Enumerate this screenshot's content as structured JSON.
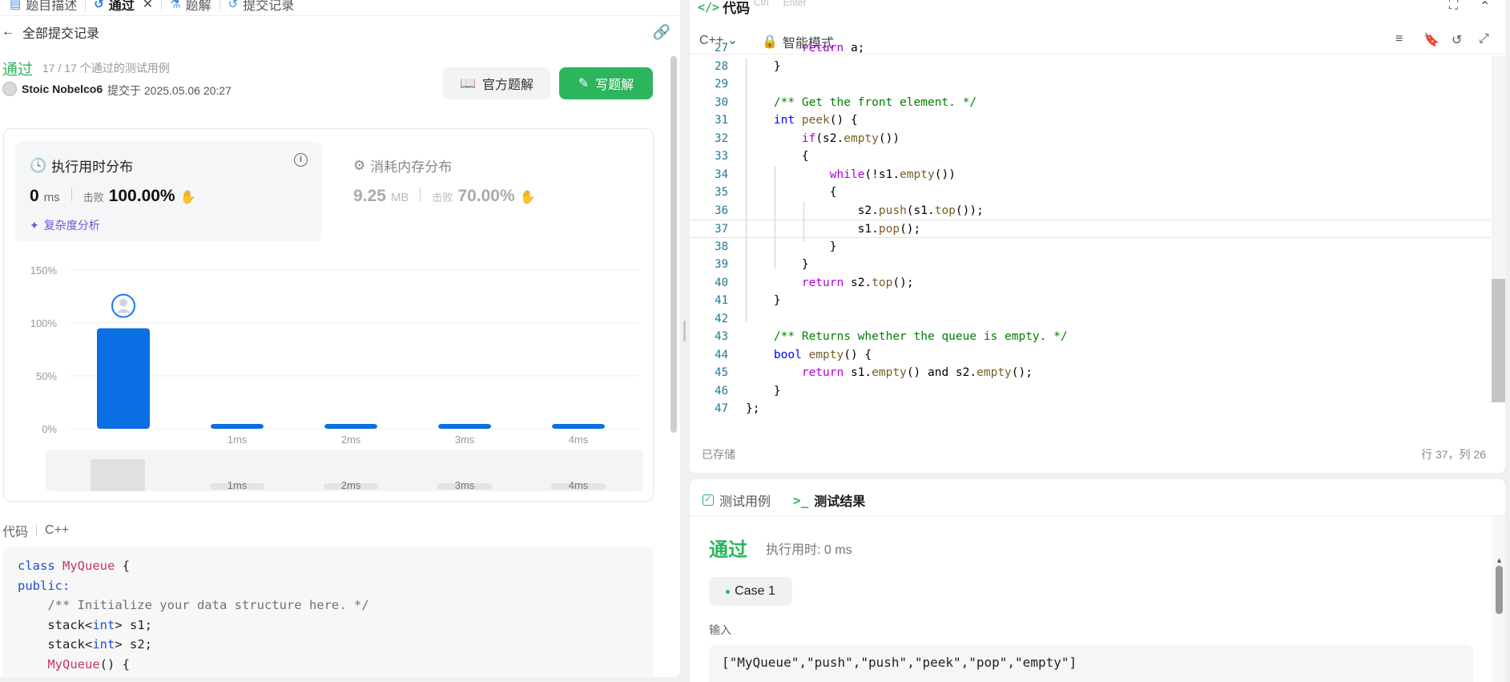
{
  "tabs": [
    {
      "label": "题目描述",
      "icon": "document-icon"
    },
    {
      "label": "通过",
      "icon": "history-icon",
      "active": true
    },
    {
      "label": "题解",
      "icon": "flask-icon"
    },
    {
      "label": "提交记录",
      "icon": "history-icon"
    }
  ],
  "back": {
    "label": "全部提交记录"
  },
  "submission": {
    "status": "通过",
    "passed_cases": "17 / 17 个通过的测试用例",
    "author": "Stoic Nobelco6",
    "submitted_at": "提交于 2025.05.06 20:27",
    "btn_official": "官方题解",
    "btn_write": "写题解"
  },
  "runtime": {
    "title": "执行用时分布",
    "value": "0",
    "unit": "ms",
    "beat_label": "击败",
    "beat_pct": "100.00%",
    "complexity_link": "复杂度分析"
  },
  "memory": {
    "title": "消耗内存分布",
    "value": "9.25",
    "unit": "MB",
    "beat_label": "击败",
    "beat_pct": "70.00%"
  },
  "chart_data": {
    "type": "bar",
    "categories": [
      "0ms",
      "1ms",
      "2ms",
      "3ms",
      "4ms"
    ],
    "tick_labels": [
      "",
      "1ms",
      "2ms",
      "3ms",
      "4ms"
    ],
    "values": [
      95,
      2,
      2,
      2,
      2
    ],
    "y_ticks": [
      "150%",
      "100%",
      "50%",
      "0%"
    ],
    "ylim": [
      0,
      150
    ],
    "bar_color": "#0a6fe2",
    "highlight_index": 0,
    "grid": true,
    "navigator_labels": [
      "1ms",
      "2ms",
      "3ms",
      "4ms"
    ]
  },
  "code_panel": {
    "label": "代码",
    "lang": "C++",
    "lines": [
      "class MyQueue {",
      "public:",
      "    /** Initialize your data structure here. */",
      "    stack<int> s1;",
      "    stack<int> s2;",
      "    MyQueue() {"
    ]
  },
  "editor": {
    "title": "代码",
    "shortcut": [
      "Ctrl",
      "Enter"
    ],
    "lang": "C++",
    "mode": "智能模式",
    "saved": "已存储",
    "cursor": "行 37，列 26",
    "lines": [
      {
        "n": "27",
        "t": "        return a;"
      },
      {
        "n": "28",
        "t": "    }"
      },
      {
        "n": "29",
        "t": ""
      },
      {
        "n": "30",
        "t": "    /** Get the front element. */"
      },
      {
        "n": "31",
        "t": "    int peek() {"
      },
      {
        "n": "32",
        "t": "        if(s2.empty())"
      },
      {
        "n": "33",
        "t": "        {"
      },
      {
        "n": "34",
        "t": "            while(!s1.empty())"
      },
      {
        "n": "35",
        "t": "            {"
      },
      {
        "n": "36",
        "t": "                s2.push(s1.top());"
      },
      {
        "n": "37",
        "t": "                s1.pop();"
      },
      {
        "n": "38",
        "t": "            }"
      },
      {
        "n": "39",
        "t": "        }"
      },
      {
        "n": "40",
        "t": "        return s2.top();"
      },
      {
        "n": "41",
        "t": "    }"
      },
      {
        "n": "42",
        "t": ""
      },
      {
        "n": "43",
        "t": "    /** Returns whether the queue is empty. */"
      },
      {
        "n": "44",
        "t": "    bool empty() {"
      },
      {
        "n": "45",
        "t": "        return s1.empty() and s2.empty();"
      },
      {
        "n": "46",
        "t": "    }"
      },
      {
        "n": "47",
        "t": "};"
      }
    ],
    "highlight_line": "37"
  },
  "results": {
    "tab_cases": "测试用例",
    "tab_result": "测试结果",
    "status": "通过",
    "time": "执行用时: 0 ms",
    "case_label": "Case 1",
    "input_label": "输入",
    "input_value": "[\"MyQueue\",\"push\",\"push\",\"peek\",\"pop\",\"empty\"]"
  }
}
